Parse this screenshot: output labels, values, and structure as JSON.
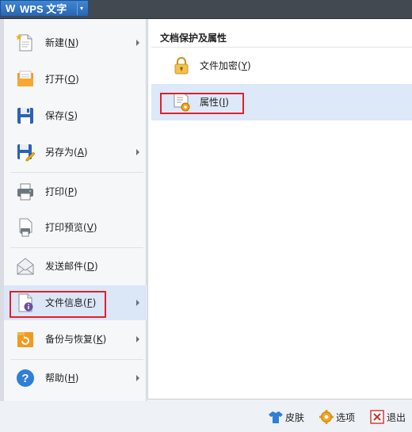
{
  "app": {
    "logo_letter": "W",
    "title": "WPS 文字",
    "dropdown": "▾"
  },
  "menu": {
    "items": [
      {
        "label": "新建",
        "key": "N",
        "icon": "new-file-icon",
        "has_submenu": true
      },
      {
        "label": "打开",
        "key": "O",
        "icon": "open-folder-icon",
        "has_submenu": false
      },
      {
        "label": "保存",
        "key": "S",
        "icon": "save-disk-icon",
        "has_submenu": false
      },
      {
        "label": "另存为",
        "key": "A",
        "icon": "save-as-icon",
        "has_submenu": true
      },
      {
        "label": "打印",
        "key": "P",
        "icon": "printer-icon",
        "has_submenu": false
      },
      {
        "label": "打印预览",
        "key": "V",
        "icon": "print-preview-icon",
        "has_submenu": false
      },
      {
        "label": "发送邮件",
        "key": "D",
        "icon": "mail-envelope-icon",
        "has_submenu": false
      },
      {
        "label": "文件信息",
        "key": "F",
        "icon": "file-info-icon",
        "has_submenu": true,
        "active": true
      },
      {
        "label": "备份与恢复",
        "key": "K",
        "icon": "backup-restore-icon",
        "has_submenu": true
      },
      {
        "label": "帮助",
        "key": "H",
        "icon": "help-icon",
        "has_submenu": true
      }
    ]
  },
  "panel": {
    "title": "文档保护及属性",
    "items": [
      {
        "label": "文件加密",
        "key": "Y",
        "icon": "lock-encrypt-icon"
      },
      {
        "label": "属性",
        "key": "I",
        "icon": "properties-icon",
        "active": true
      }
    ]
  },
  "bottom": {
    "skin": "皮肤",
    "options": "选项",
    "exit": "退出"
  },
  "colors": {
    "highlight_border": "#e0212b",
    "app_button": "#2f6fbf",
    "active_row": "#dbe6f7"
  }
}
